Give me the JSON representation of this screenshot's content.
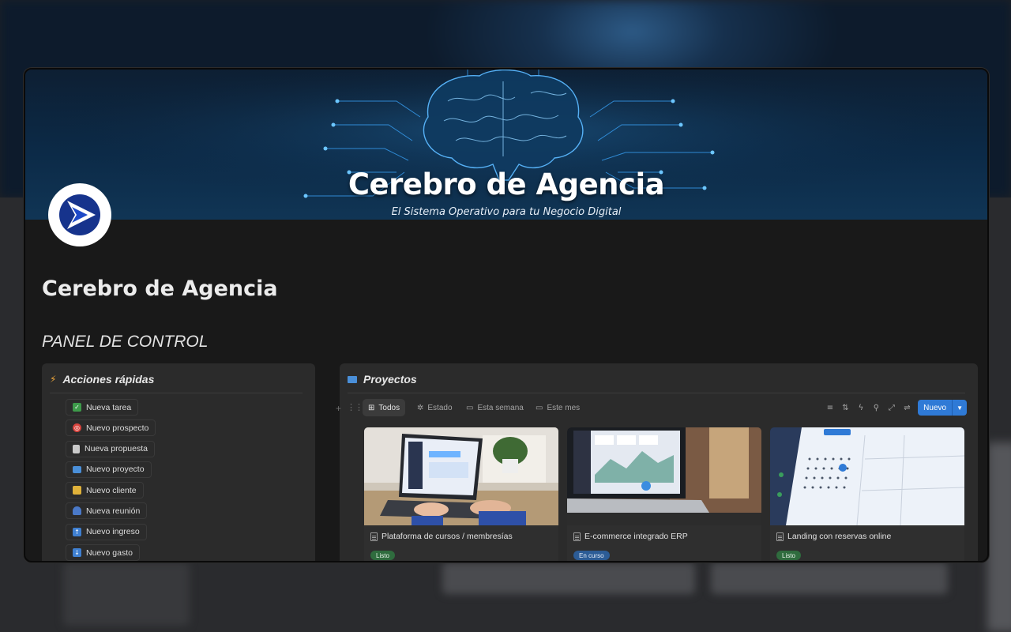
{
  "cover": {
    "title": "Cerebro de Agencia",
    "subtitle": "El Sistema Operativo para tu Negocio Digital"
  },
  "page": {
    "icon": "play-arrow-logo-icon",
    "title": "Cerebro de Agencia",
    "section_heading": "PANEL DE CONTROL"
  },
  "quick_actions": {
    "icon": "lightning-icon",
    "title": "Acciones rápidas",
    "items": [
      {
        "label": "Nueva tarea",
        "icon": "check-box-icon",
        "color": "#3d9a4a"
      },
      {
        "label": "Nuevo prospecto",
        "icon": "target-icon",
        "color": "#d9433d"
      },
      {
        "label": "Nueva propuesta",
        "icon": "document-icon",
        "color": "#b8b8b8"
      },
      {
        "label": "Nuevo proyecto",
        "icon": "folder-icon",
        "color": "#4a8fd8"
      },
      {
        "label": "Nuevo cliente",
        "icon": "note-icon",
        "color": "#e0b23a"
      },
      {
        "label": "Nueva reunión",
        "icon": "people-icon",
        "color": "#4a79c8"
      },
      {
        "label": "Nuevo ingreso",
        "icon": "income-icon",
        "color": "#3f7fd0"
      },
      {
        "label": "Nuevo gasto",
        "icon": "expense-icon",
        "color": "#3f7fd0"
      }
    ]
  },
  "projects": {
    "icon": "folder-icon",
    "title": "Proyectos",
    "tabs": [
      {
        "label": "Todos",
        "icon": "gallery-icon",
        "active": true
      },
      {
        "label": "Estado",
        "icon": "loader-icon",
        "active": false
      },
      {
        "label": "Esta semana",
        "icon": "calendar-icon",
        "active": false
      },
      {
        "label": "Este mes",
        "icon": "calendar-icon",
        "active": false
      }
    ],
    "toolbar": {
      "new_label": "Nuevo"
    },
    "cards": [
      {
        "title": "Plataforma de cursos / membresías",
        "status": "Listo"
      },
      {
        "title": "E-commerce integrado ERP",
        "status": "En curso"
      },
      {
        "title": "Landing con reservas online",
        "status": "Listo"
      }
    ]
  },
  "colors": {
    "accent": "#2f7ad6",
    "status_done": "#2f6c3e",
    "status_in_progress": "#2c5c96",
    "panel_bg": "#2b2b2b",
    "page_bg": "#191919"
  }
}
